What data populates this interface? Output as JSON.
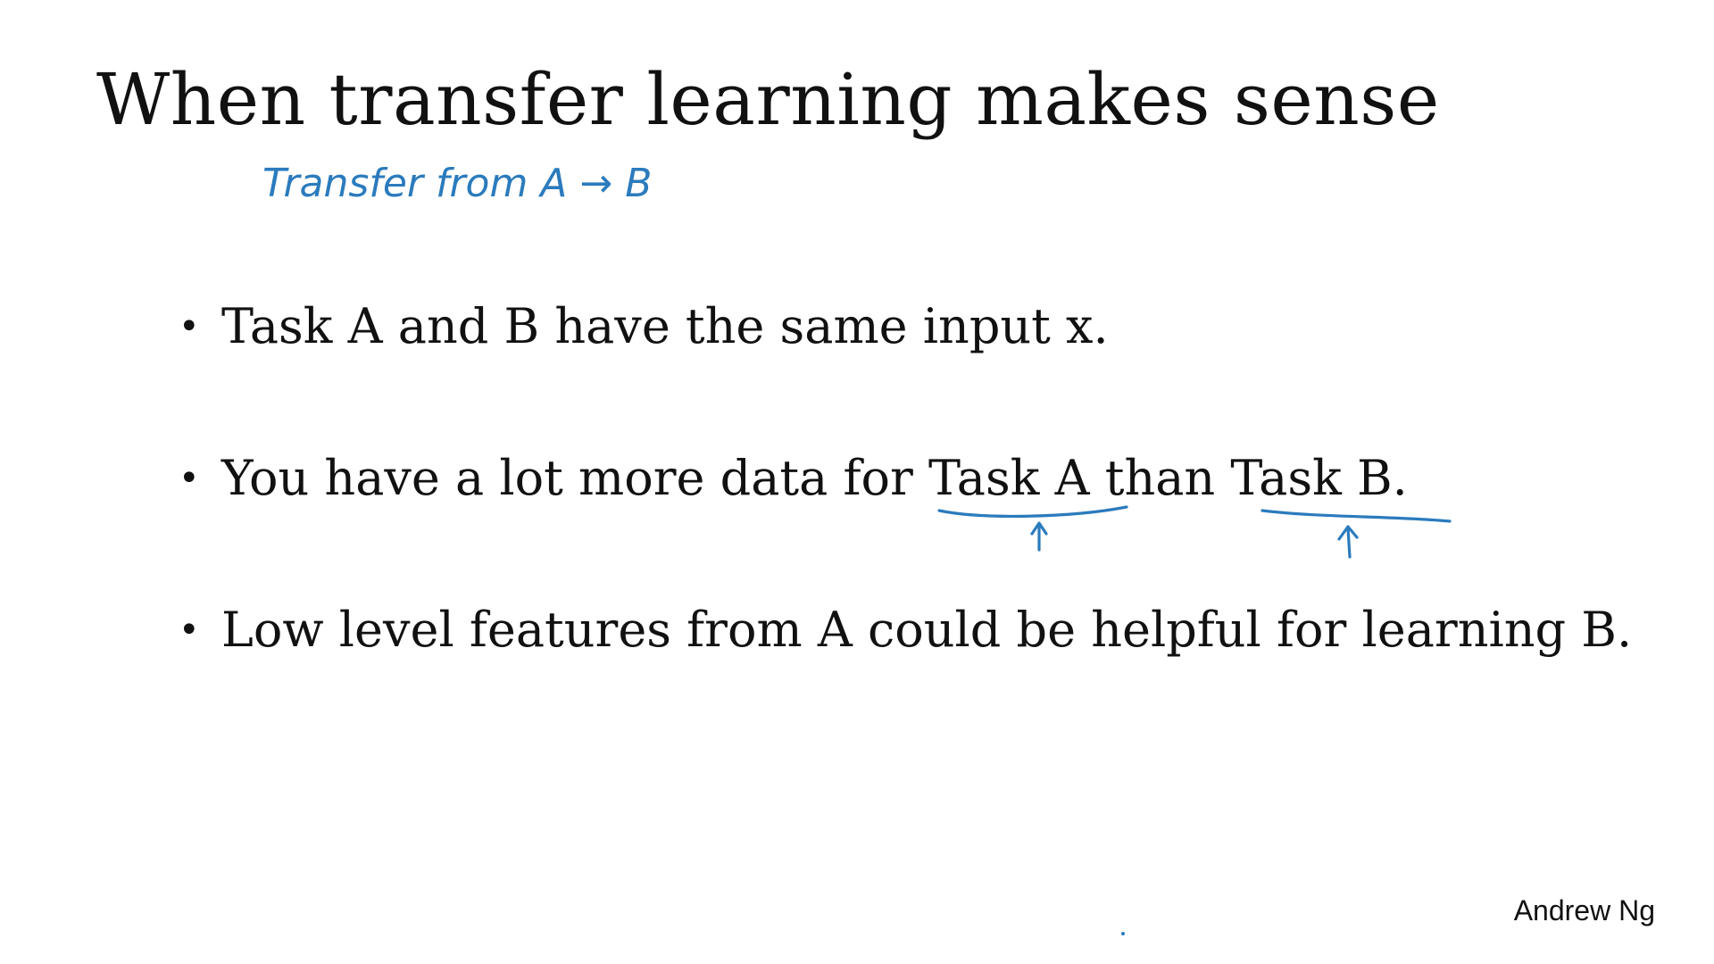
{
  "slide": {
    "title": "When transfer learning makes sense",
    "bullet_marker": "•",
    "bullets": [
      "Task A and B have the same input x.",
      "You have a lot more data for Task A than Task B.",
      "Low level features from A could be helpful for learning B."
    ],
    "attribution": "Andrew Ng"
  },
  "annotations": {
    "handwritten_note": "Transfer from A → B",
    "ink_color": "#2b7bbd"
  }
}
